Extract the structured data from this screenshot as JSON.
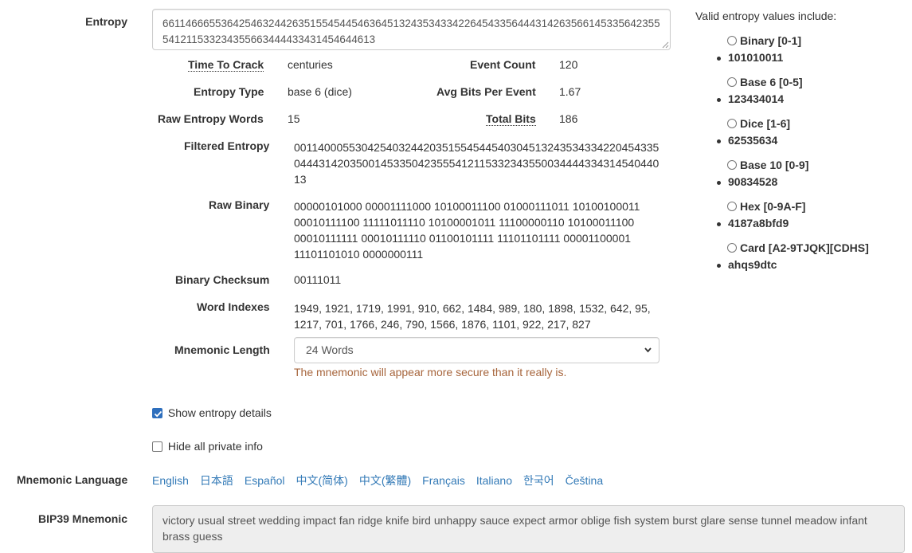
{
  "entropy": {
    "label": "Entropy",
    "value": "661146665536425463244263515545445463645132435343342264543356444314263566145335642355541211533234355663444433431454644613"
  },
  "details": {
    "time_to_crack_label": "Time To Crack",
    "time_to_crack_value": "centuries",
    "event_count_label": "Event Count",
    "event_count_value": "120",
    "entropy_type_label": "Entropy Type",
    "entropy_type_value": "base 6 (dice)",
    "avg_bits_label": "Avg Bits Per Event",
    "avg_bits_value": "1.67",
    "raw_words_label": "Raw Entropy Words",
    "raw_words_value": "15",
    "total_bits_label": "Total Bits",
    "total_bits_value": "186",
    "filtered_label": "Filtered Entropy",
    "filtered_value": "001140005530425403244203515545445403045132435343342204543350444314203500145335042355541211533234355003444433431454044013",
    "raw_binary_label": "Raw Binary",
    "raw_binary_value": "00000101000 00001111000 10100011100 01000111011 10100100011 00010111100 11111011110 10100001011 11100000110 10100011100 00010111111 00010111110 01100101111 11101101111 00001100001 11101101010 0000000111",
    "checksum_label": "Binary Checksum",
    "checksum_value": "00111011",
    "word_indexes_label": "Word Indexes",
    "word_indexes_value": "1949, 1921, 1719, 1991, 910, 662, 1484, 989, 180, 1898, 1532, 642, 95, 1217, 701, 1766, 246, 790, 1566, 1876, 1101, 922, 217, 827",
    "mnemonic_length_label": "Mnemonic Length",
    "mnemonic_length_value": "24 Words",
    "warning": "The mnemonic will appear more secure than it really is."
  },
  "options": {
    "show_details_label": "Show entropy details",
    "show_details_checked": true,
    "hide_private_label": "Hide all private info",
    "hide_private_checked": false
  },
  "language": {
    "label": "Mnemonic Language",
    "links": [
      "English",
      "日本語",
      "Español",
      "中文(简体)",
      "中文(繁體)",
      "Français",
      "Italiano",
      "한국어",
      "Čeština"
    ]
  },
  "mnemonic": {
    "label": "BIP39 Mnemonic",
    "value": "victory usual street wedding impact fan ridge knife bird unhappy sauce expect armor oblige fish system burst glare sense tunnel meadow infant brass guess"
  },
  "valid_entropy": {
    "title": "Valid entropy values include:",
    "items": [
      {
        "label": "Binary [0-1]",
        "example": "101010011"
      },
      {
        "label": "Base 6 [0-5]",
        "example": "123434014"
      },
      {
        "label": "Dice [1-6]",
        "example": "62535634"
      },
      {
        "label": "Base 10 [0-9]",
        "example": "90834528"
      },
      {
        "label": "Hex [0-9A-F]",
        "example": "4187a8bfd9"
      },
      {
        "label": "Card [A2-9TJQK][CDHS]",
        "example": "ahqs9dtc"
      }
    ]
  },
  "colors": {
    "link": "#337ab7",
    "warning": "#a7653c",
    "checkbox": "#2e6fbd"
  }
}
